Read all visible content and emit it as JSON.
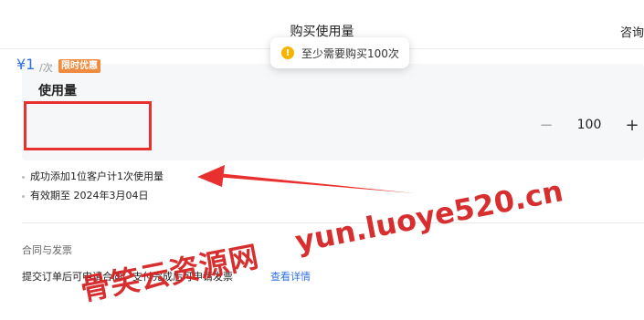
{
  "header": {
    "title": "购买使用量",
    "consult_label": "咨询"
  },
  "toast": {
    "icon": "warning-icon",
    "text": "至少需要购买100次"
  },
  "usage_card": {
    "title": "使用量",
    "price": "¥1",
    "unit": "/次",
    "promo_badge": "限时优惠",
    "stepper": {
      "minus": "−",
      "value": "100",
      "plus": "+"
    }
  },
  "bullets": [
    "成功添加1位客户计1次使用量",
    "有效期至 2024年3月04日"
  ],
  "contract": {
    "title": "合同与发票",
    "text": "提交订单后可申请合同，支付完成后可申请发票",
    "link": "查看详情"
  },
  "watermark": {
    "cn": "骨笑云资源网",
    "en": "yun.luoye520.cn"
  },
  "colors": {
    "accent": "#2f6fe0",
    "highlight": "#e8312e",
    "promo": "#f08a3e",
    "watermark": "#d52020"
  }
}
